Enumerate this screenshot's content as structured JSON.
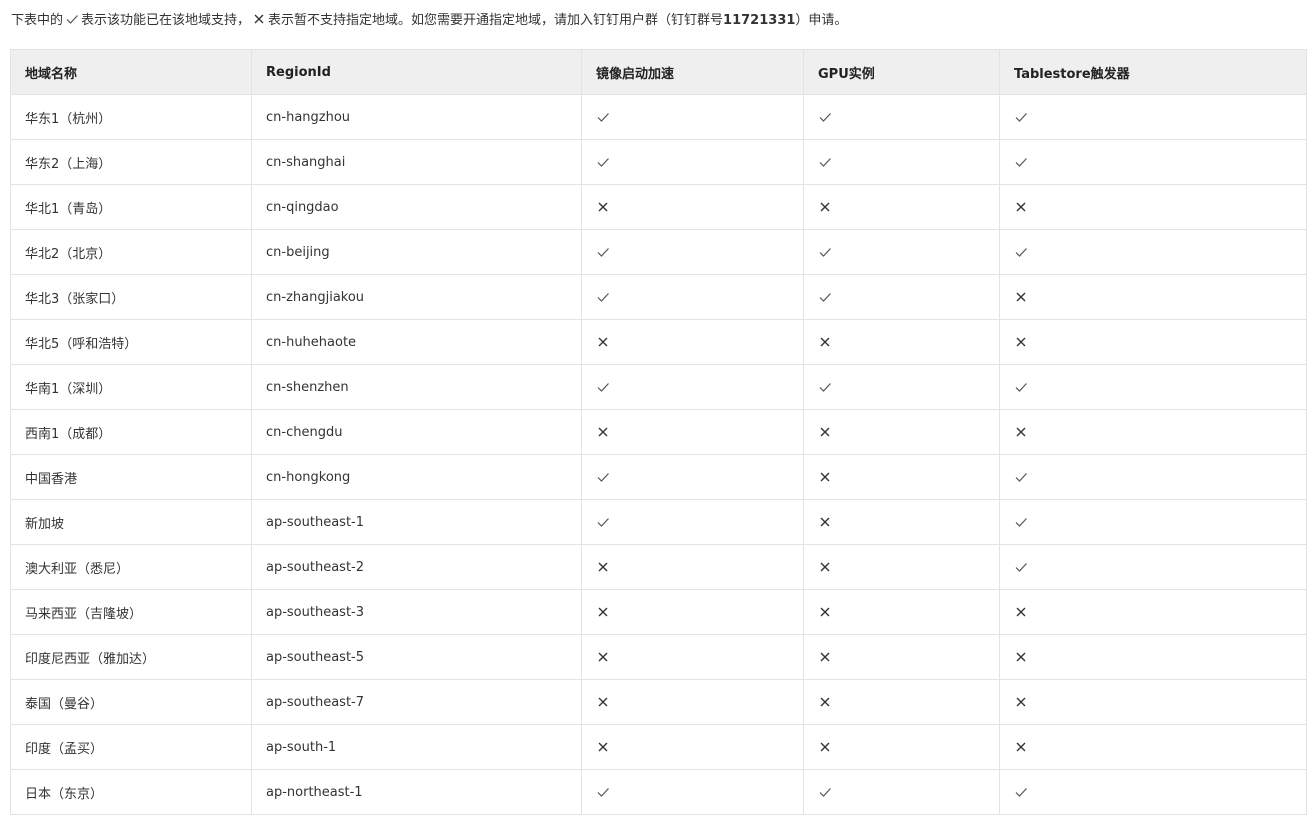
{
  "intro": {
    "part1": "下表中的",
    "part2": "表示该功能已在该地域支持，",
    "part3": "表示暂不支持指定地域。如您需要开通指定地域，请加入钉钉用户群（钉钉群号",
    "group_id": "11721331",
    "part4": "）申请。",
    "check_icon": "check-icon",
    "cross_icon": "cross-icon"
  },
  "table": {
    "headers": [
      "地域名称",
      "RegionId",
      "镜像启动加速",
      "GPU实例",
      "Tablestore触发器"
    ],
    "rows": [
      {
        "name": "华东1（杭州）",
        "region_id": "cn-hangzhou",
        "image_accel": true,
        "gpu": true,
        "tablestore": true
      },
      {
        "name": "华东2（上海）",
        "region_id": "cn-shanghai",
        "image_accel": true,
        "gpu": true,
        "tablestore": true
      },
      {
        "name": "华北1（青岛）",
        "region_id": "cn-qingdao",
        "image_accel": false,
        "gpu": false,
        "tablestore": false
      },
      {
        "name": "华北2（北京）",
        "region_id": "cn-beijing",
        "image_accel": true,
        "gpu": true,
        "tablestore": true
      },
      {
        "name": "华北3（张家口）",
        "region_id": "cn-zhangjiakou",
        "image_accel": true,
        "gpu": true,
        "tablestore": false
      },
      {
        "name": "华北5（呼和浩特）",
        "region_id": "cn-huhehaote",
        "image_accel": false,
        "gpu": false,
        "tablestore": false
      },
      {
        "name": "华南1（深圳）",
        "region_id": "cn-shenzhen",
        "image_accel": true,
        "gpu": true,
        "tablestore": true
      },
      {
        "name": "西南1（成都）",
        "region_id": "cn-chengdu",
        "image_accel": false,
        "gpu": false,
        "tablestore": false
      },
      {
        "name": "中国香港",
        "region_id": "cn-hongkong",
        "image_accel": true,
        "gpu": false,
        "tablestore": true
      },
      {
        "name": "新加坡",
        "region_id": "ap-southeast-1",
        "image_accel": true,
        "gpu": false,
        "tablestore": true
      },
      {
        "name": "澳大利亚（悉尼）",
        "region_id": "ap-southeast-2",
        "image_accel": false,
        "gpu": false,
        "tablestore": true
      },
      {
        "name": "马来西亚（吉隆坡）",
        "region_id": "ap-southeast-3",
        "image_accel": false,
        "gpu": false,
        "tablestore": false
      },
      {
        "name": "印度尼西亚（雅加达）",
        "region_id": "ap-southeast-5",
        "image_accel": false,
        "gpu": false,
        "tablestore": false
      },
      {
        "name": "泰国（曼谷）",
        "region_id": "ap-southeast-7",
        "image_accel": false,
        "gpu": false,
        "tablestore": false
      },
      {
        "name": "印度（孟买）",
        "region_id": "ap-south-1",
        "image_accel": false,
        "gpu": false,
        "tablestore": false
      },
      {
        "name": "日本（东京）",
        "region_id": "ap-northeast-1",
        "image_accel": true,
        "gpu": true,
        "tablestore": true
      }
    ]
  }
}
